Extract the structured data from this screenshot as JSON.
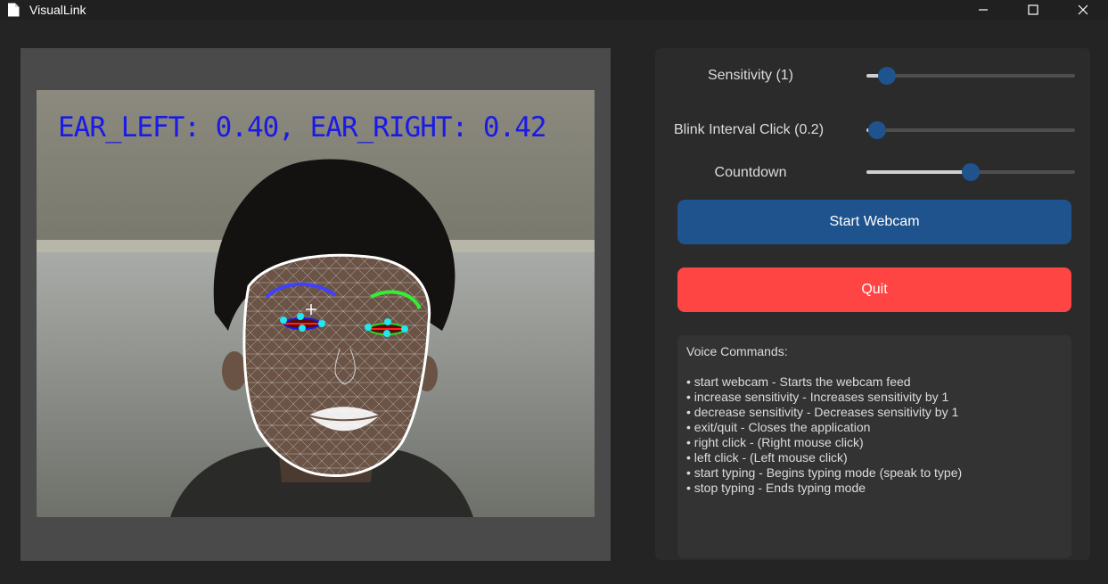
{
  "window": {
    "title": "VisualLink",
    "icons": [
      "document-icon",
      "minimize-icon",
      "maximize-icon",
      "close-icon"
    ]
  },
  "video": {
    "overlay_text": "EAR_LEFT: 0.40, EAR_RIGHT: 0.42",
    "overlay_color": "#1a1ae6"
  },
  "controls": {
    "sensitivity": {
      "label": "Sensitivity (1)",
      "value_fraction": 0.1
    },
    "blink_interval": {
      "label": "Blink Interval Click (0.2)",
      "value_fraction": 0.05
    },
    "countdown": {
      "label": "Countdown",
      "value_fraction": 0.5
    },
    "start_button": {
      "label": "Start Webcam",
      "color": "#1f538d"
    },
    "quit_button": {
      "label": "Quit",
      "color": "#ff4444"
    }
  },
  "voice": {
    "title": "Voice Commands:",
    "commands": [
      "• start webcam - Starts the webcam feed",
      "• increase sensitivity - Increases sensitivity by 1",
      "• decrease sensitivity - Decreases sensitivity by 1",
      "• exit/quit - Closes the application",
      "• right click - (Right mouse click)",
      "• left click - (Left mouse click)",
      "• start typing - Begins typing mode (speak to type)",
      "• stop typing - Ends typing mode"
    ]
  }
}
